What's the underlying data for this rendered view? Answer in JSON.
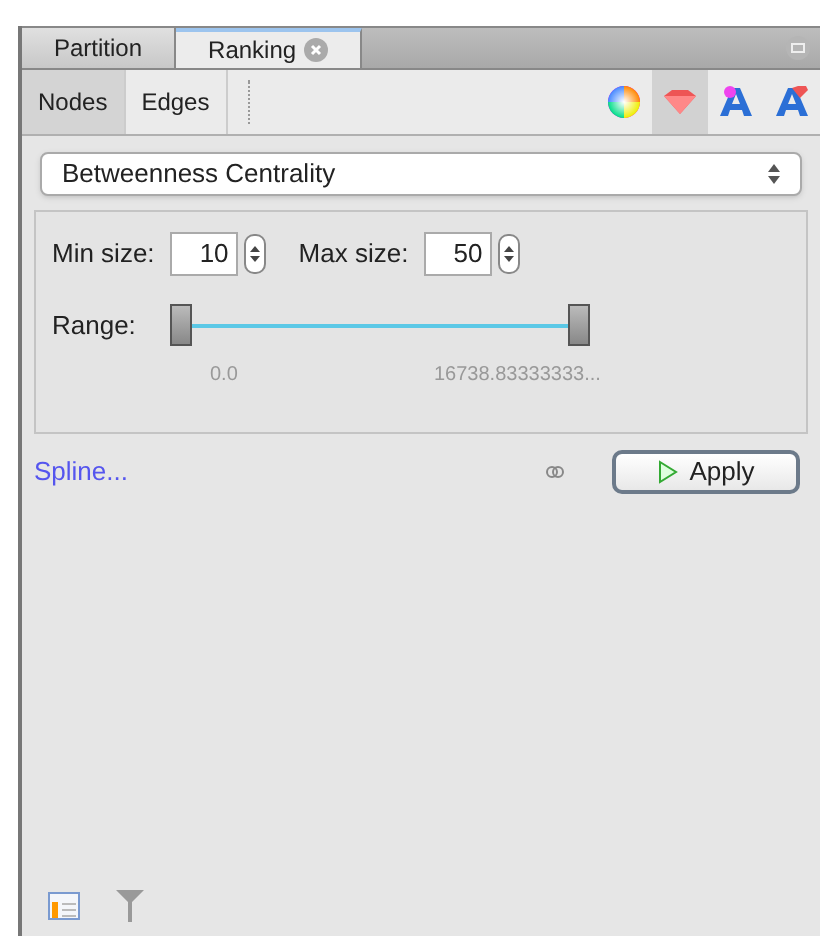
{
  "tabs": [
    {
      "label": "Partition",
      "selected": false,
      "closable": false
    },
    {
      "label": "Ranking",
      "selected": true,
      "closable": true
    }
  ],
  "element_tabs": [
    {
      "label": "Nodes",
      "selected": true
    },
    {
      "label": "Edges",
      "selected": false
    }
  ],
  "tools": [
    {
      "kind": "color",
      "selected": false
    },
    {
      "kind": "size",
      "selected": true
    },
    {
      "kind": "label-color",
      "selected": false
    },
    {
      "kind": "label-size",
      "selected": false
    }
  ],
  "ranking": {
    "value": "Betweenness Centrality"
  },
  "min_size": {
    "label": "Min size:",
    "value": "10"
  },
  "max_size": {
    "label": "Max size:",
    "value": "50"
  },
  "range": {
    "label": "Range:",
    "min": "0.0",
    "max": "16738.83333333..."
  },
  "spline_link": "Spline...",
  "apply_button": "Apply"
}
